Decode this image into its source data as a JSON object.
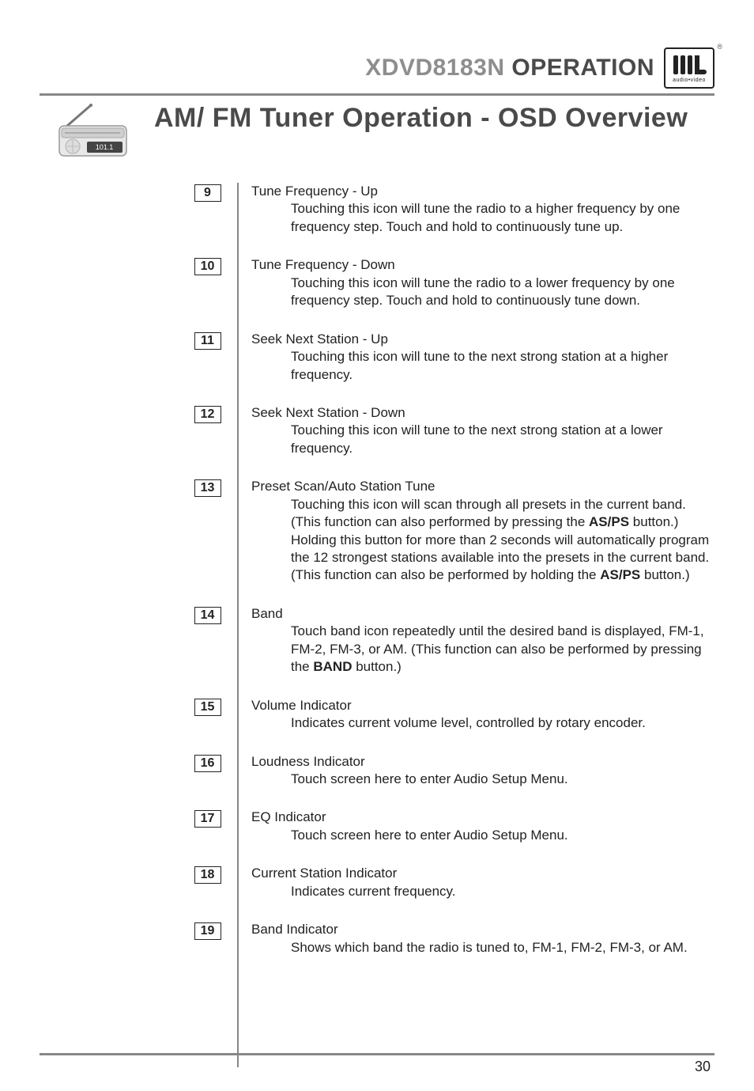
{
  "header": {
    "model": "XDVD8183N",
    "operation": "OPERATION",
    "brand_name": "DUAL",
    "brand_sub": "audio•video",
    "reg": "®"
  },
  "section_title": "AM/ FM Tuner Operation - OSD Overview",
  "radio_icon_freq": "101.1",
  "items": [
    {
      "num": "9",
      "title": "Tune Frequency - Up",
      "desc": "Touching this icon will tune the radio to a higher frequency by one frequency step. Touch and hold to continuously tune up."
    },
    {
      "num": "10",
      "title": "Tune Frequency - Down",
      "desc": "Touching this icon will tune the radio to a lower frequency by one frequency step. Touch and hold to continuously tune down."
    },
    {
      "num": "11",
      "title": "Seek Next Station - Up",
      "desc": "Touching this icon will tune to the next strong station at a higher frequency."
    },
    {
      "num": "12",
      "title": "Seek Next Station - Down",
      "desc": "Touching this icon will tune to the next strong station at a lower frequency."
    },
    {
      "num": "13",
      "title": "Preset Scan/Auto Station Tune",
      "desc_pre": "Touching this icon will scan through all presets in the current band. (This function can also performed by pressing the ",
      "desc_bold1": "AS/PS",
      "desc_mid": " button.) Holding this button for more than 2 seconds will automatically program the 12 strongest stations available into the presets in the current band. (This function can also be performed by holding the ",
      "desc_bold2": "AS/PS",
      "desc_post": " button.)"
    },
    {
      "num": "14",
      "title": "Band",
      "desc_pre": "Touch band icon repeatedly until the desired band is displayed, FM-1, FM-2, FM-3, or AM. (This function can also be performed by pressing the ",
      "desc_bold1": "BAND",
      "desc_post": " button.)"
    },
    {
      "num": "15",
      "title": "Volume Indicator",
      "desc": "Indicates current volume level, controlled by rotary encoder."
    },
    {
      "num": "16",
      "title": "Loudness Indicator",
      "desc": "Touch screen here to enter Audio Setup Menu."
    },
    {
      "num": "17",
      "title": "EQ Indicator",
      "desc": "Touch screen here to enter Audio Setup Menu."
    },
    {
      "num": "18",
      "title": "Current Station Indicator",
      "desc": "Indicates current frequency."
    },
    {
      "num": "19",
      "title": "Band Indicator",
      "desc": "Shows which band the radio is tuned to, FM-1, FM-2, FM-3, or AM."
    }
  ],
  "page_number": "30"
}
